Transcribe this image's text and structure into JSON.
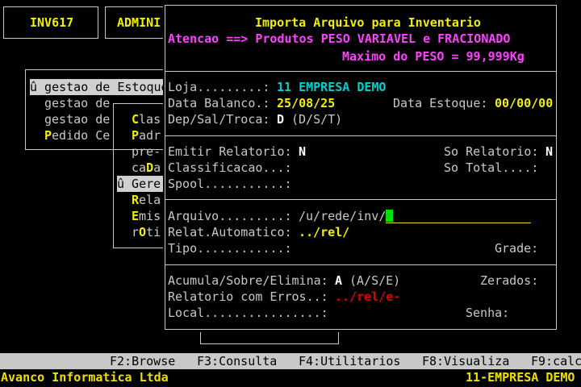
{
  "top_tabs": {
    "inv617": "INV617",
    "admin": "ADMINI"
  },
  "bg_menu": {
    "items": [
      {
        "label": "û gestao de Estoque"
      },
      {
        "label": "gestao de"
      },
      {
        "label": "gestao de"
      },
      {
        "hot": "P",
        "rest": "edido Ce"
      }
    ]
  },
  "sub_menu": {
    "items": [
      {
        "hot": "C",
        "rest": "las"
      },
      {
        "hot": "P",
        "rest": "adr"
      },
      {
        "hot": "",
        "rest": "pre-"
      },
      {
        "pre": "ca",
        "hot": "D",
        "rest": "a"
      },
      {
        "label": "û Gere"
      },
      {
        "hot": "R",
        "rest": "ela"
      },
      {
        "hot": "E",
        "rest": "mis"
      },
      {
        "pre": "r",
        "hot": "O",
        "rest": "ti"
      }
    ]
  },
  "dialog": {
    "title": "Importa Arquivo para Inventario",
    "warning": "Atencao ==> Produtos PESO VARIAVEL e FRACIONADO",
    "max_weight": "Maximo do PESO = 99,999Kg",
    "loja_label": "Loja.........:",
    "loja_value": "11 EMPRESA DEMO",
    "data_balanco_label": "Data Balanco.:",
    "data_balanco_value": "25/08/25",
    "data_estoque_label": "Data Estoque:",
    "data_estoque_value": "00/00/00",
    "dep_label": "Dep/Sal/Troca:",
    "dep_value": "D",
    "dep_options": "(D/S/T)",
    "emitir_label": "Emitir Relatorio:",
    "emitir_value": "N",
    "so_relatorio_label": "So Relatorio:",
    "so_relatorio_value": "N",
    "classificacao_label": "Classificacao...:",
    "so_total_label": "So Total....:",
    "spool_label": "Spool...........:",
    "arquivo_label": "Arquivo.........:",
    "arquivo_value": "/u/rede/inv/",
    "relat_auto_label": "Relat.Automatico:",
    "relat_auto_value": "../rel/",
    "tipo_label": "Tipo............:",
    "grade_label": "Grade:",
    "acumula_label": "Acumula/Sobre/Elimina:",
    "acumula_value": "A",
    "acumula_options": "(A/S/E)",
    "zerados_label": "Zerados:",
    "rel_erros_label": "Relatorio com Erros..:",
    "rel_erros_value": "../rel/e-",
    "local_label": "Local................:",
    "senha_label": "Senha:"
  },
  "function_bar": {
    "f2": "F2:Browse",
    "f3": "F3:Consulta",
    "f4": "F4:Utilitarios",
    "f8": "F8:Visualiza",
    "f9": "F9:calc"
  },
  "status_bar": {
    "company": "Avanco Informatica Ltda",
    "empresa": "11-EMPRESA DEMO"
  }
}
